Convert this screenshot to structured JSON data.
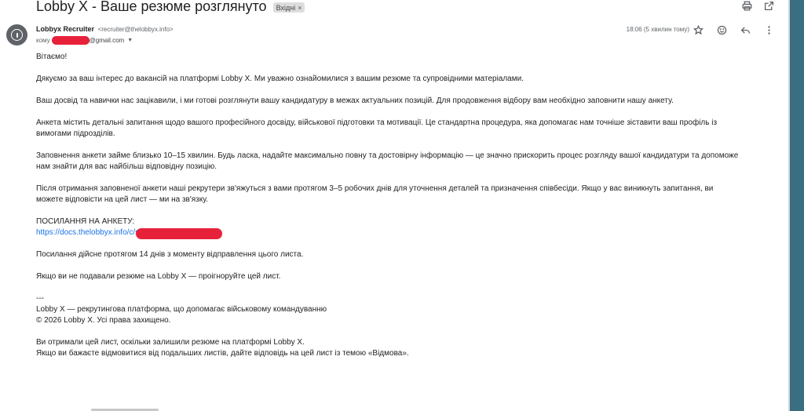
{
  "email": {
    "subject": "Lobby X - Ваше резюме розглянуто",
    "label": "Вхідні",
    "label_close": "×",
    "sender_name": "Lobbyx Recruiter",
    "sender_email": "<recruiter@thelobbyx.info>",
    "recipient_prefix": "кому ",
    "recipient_suffix": "@gmail.com",
    "time": "18:06 (5 хвилин тому)"
  },
  "icons": {
    "print": "print-icon",
    "open_new_window": "open-in-new-icon",
    "star": "star-icon",
    "emoji": "emoji-icon",
    "reply": "reply-icon",
    "more": "more-vert-icon",
    "avatar": "warning-avatar-icon",
    "caret": "chevron-down-icon"
  },
  "body": {
    "greeting": "Вітаємо!",
    "p1": "Дякуємо за ваш інтерес до вакансій на платформі Lobby X. Ми уважно ознайомилися з вашим резюме та супровідними матеріалами.",
    "p2": "Ваш досвід та навички нас зацікавили, і ми готові розглянути вашу кандидатуру в межах актуальних позицій. Для продовження відбору вам необхідно заповнити нашу анкету.",
    "p3_l1": "Анкета містить детальні запитання щодо вашого професійного досвіду, військової підготовки та мотивації. Це стандартна процедура, яка допомагає нам точніше зіставити ваш профіль із",
    "p3_l2": "вимогами підрозділів.",
    "p4_l1": "Заповнення анкети займе близько 10–15 хвилин. Будь ласка, надайте максимально повну та достовірну інформацію — це значно прискорить процес розгляду вашої кандидатури та допоможе",
    "p4_l2": "нам знайти для вас найбільш відповідну позицію.",
    "p5_l1": "Після отримання заповненої анкети наші рекрутери зв'яжуться з вами протягом 3–5 робочих днів для уточнення деталей та призначення співбесіди. Якщо у вас виникнуть запитання, ви",
    "p5_l2": "можете відповісти на цей лист — ми на зв'язку.",
    "link_label": "ПОСИЛАННЯ НА АНКЕТУ:",
    "link_text": "https://docs.thelobbyx.info/c/s",
    "validity": "Посилання дійсне протягом 14 днів з моменту відправлення цього листа.",
    "ignore": "Якщо ви не подавали резюме на Lobby X — проігноруйте цей лист.",
    "sig_sep": "---",
    "sig_l1": "Lobby X — рекрутингова платформа, що допомагає військовому командуванню",
    "sig_l2": "© 2026 Lobby X. Усі права захищено.",
    "foot_l1": "Ви отримали цей лист, оскільки залишили резюме на платформі Lobby X.",
    "foot_l2": "Якщо ви бажаєте відмовитися від подальших листів, дайте відповідь на цей лист із темою «Відмова»."
  }
}
